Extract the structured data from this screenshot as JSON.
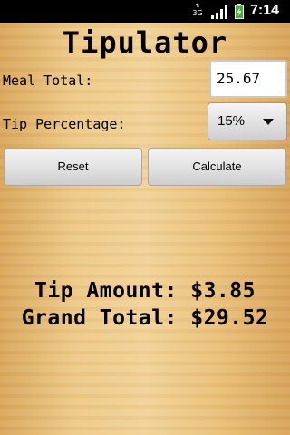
{
  "status_bar": {
    "network_top": "3G",
    "network_label": "3G",
    "time": "7:14"
  },
  "app": {
    "title": "Tipulator"
  },
  "form": {
    "meal_total_label": "Meal Total:",
    "meal_total_value": "25.67",
    "tip_percentage_label": "Tip Percentage:",
    "tip_percentage_value": "15%"
  },
  "buttons": {
    "reset_label": "Reset",
    "calculate_label": "Calculate"
  },
  "results": {
    "tip_amount_label": "Tip Amount:",
    "tip_amount_value": "$3.85",
    "grand_total_label": "Grand Total:",
    "grand_total_value": "$29.52"
  },
  "colors": {
    "background_wood": "#edc987",
    "status_bar": "#000000",
    "battery_green": "#4caf35"
  },
  "icons": [
    "network-3g-icon",
    "signal-strength-icon",
    "battery-charging-icon",
    "dropdown-arrow-icon"
  ]
}
